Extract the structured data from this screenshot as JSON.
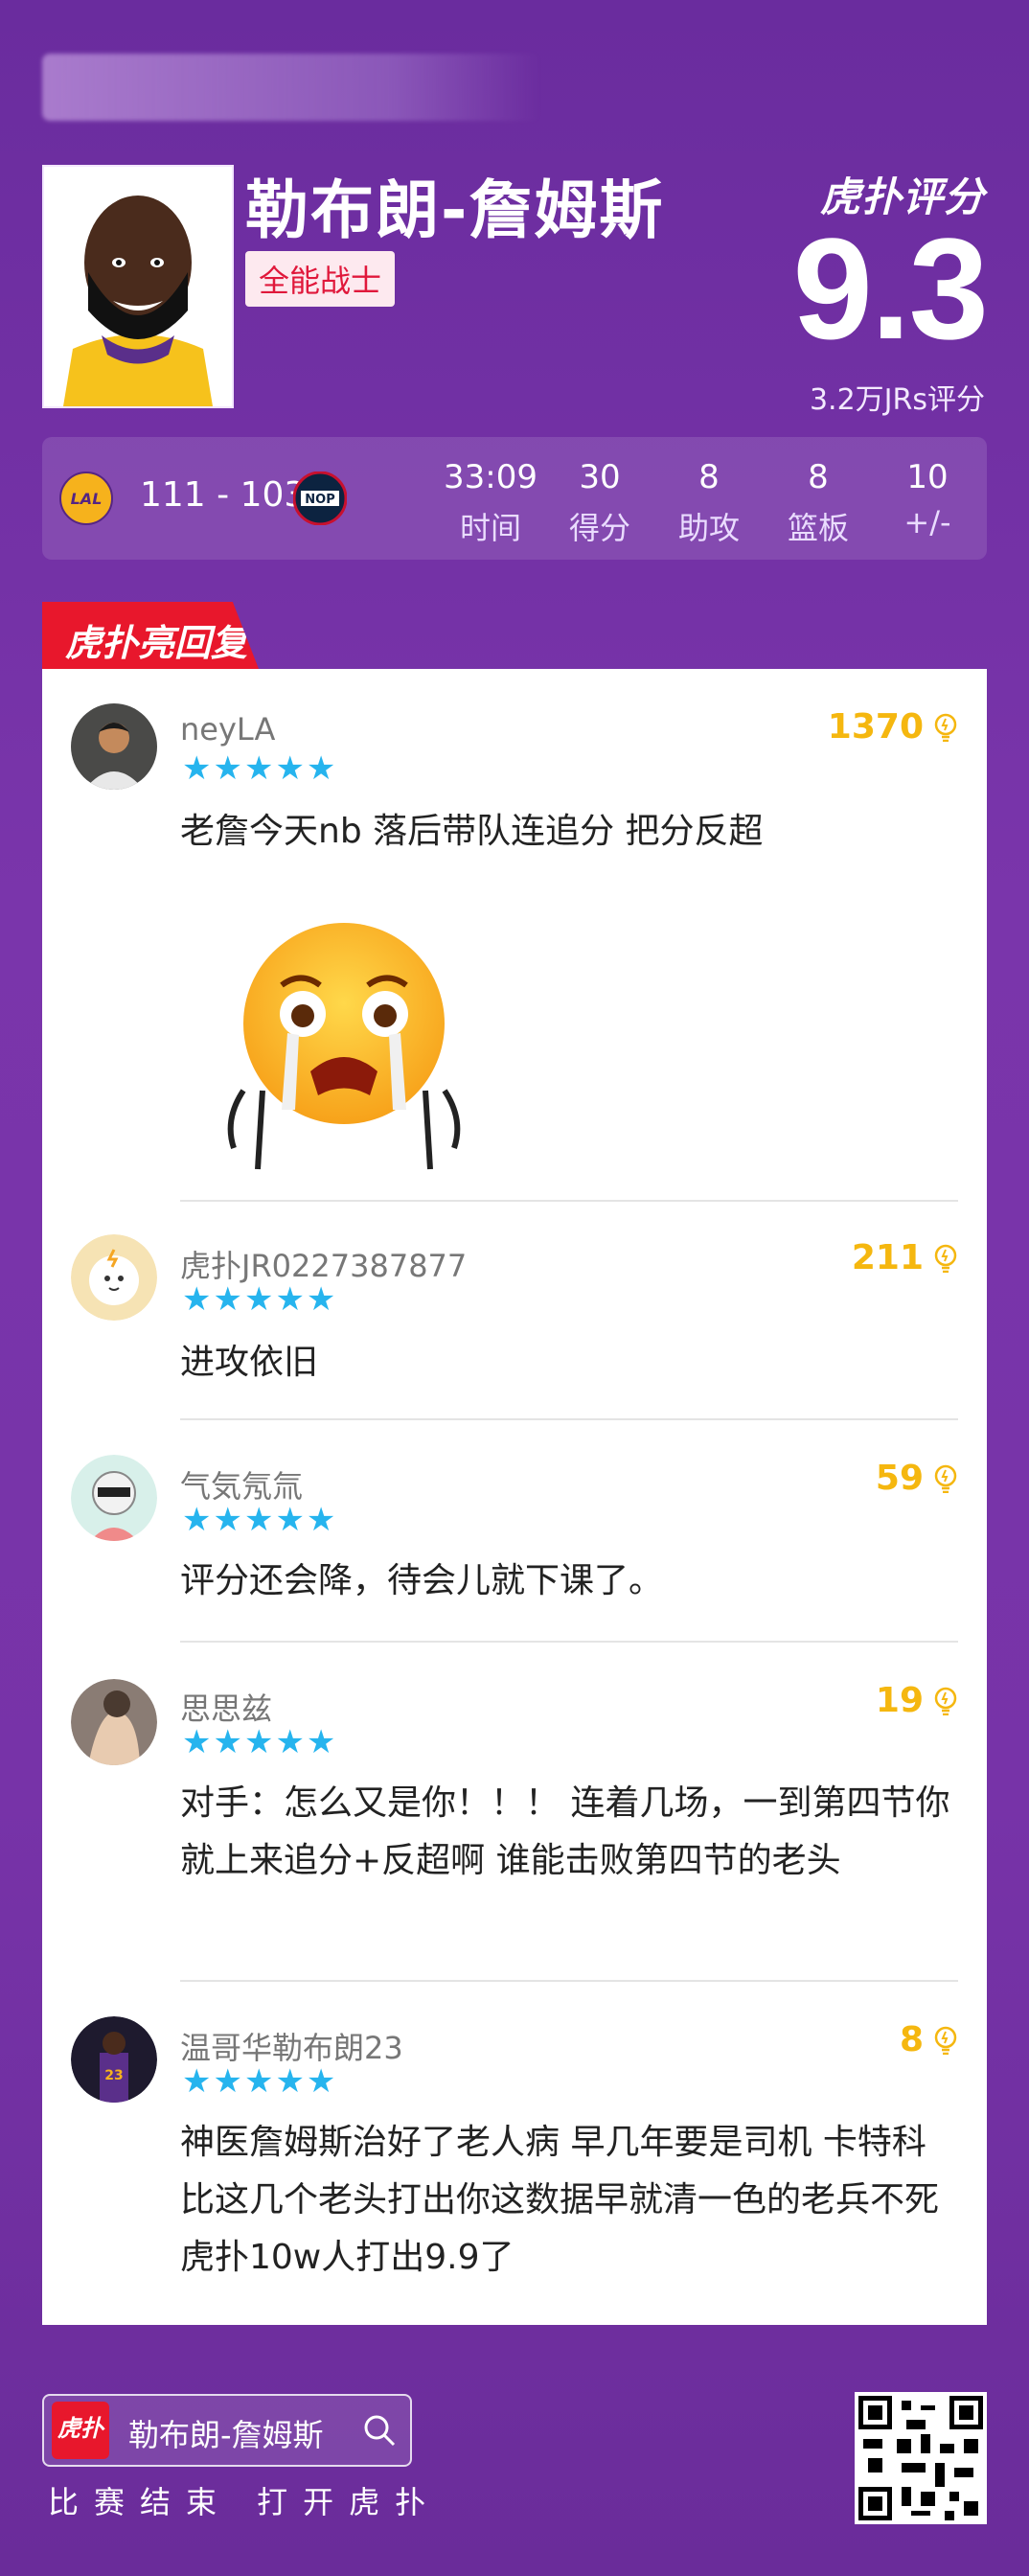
{
  "player": {
    "name": "勒布朗-詹姆斯",
    "tag": "全能战士"
  },
  "rating": {
    "brand": "虎扑评分",
    "score": "9.3",
    "votes": "3.2万JRs评分"
  },
  "game": {
    "score": "111 - 103",
    "home_logo": "LAL",
    "away_logo": "NOP",
    "stats": [
      {
        "value": "33:09",
        "label": "时间"
      },
      {
        "value": "30",
        "label": "得分"
      },
      {
        "value": "8",
        "label": "助攻"
      },
      {
        "value": "8",
        "label": "篮板"
      },
      {
        "value": "10",
        "label": "+/-"
      }
    ]
  },
  "section_title": "虎扑亮回复",
  "comments": [
    {
      "user": "neyLA",
      "stars": 5,
      "likes": "1370",
      "text": "老詹今天nb 落后带队连追分 把分反超",
      "sticker": "crying-emoji"
    },
    {
      "user": "虎扑JR0227387877",
      "stars": 5,
      "likes": "211",
      "text": "进攻依旧"
    },
    {
      "user": "气気氖氚",
      "stars": 5,
      "likes": "59",
      "text": "评分还会降，待会儿就下课了。"
    },
    {
      "user": "思思兹",
      "stars": 5,
      "likes": "19",
      "text": "对手：怎么又是你！！！ 连着几场，一到第四节你就上来追分+反超啊 谁能击败第四节的老头"
    },
    {
      "user": "温哥华勒布朗23",
      "stars": 5,
      "likes": "8",
      "text": "神医詹姆斯治好了老人病 早几年要是司机 卡特科比这几个老头打出你这数据早就清一色的老兵不死 虎扑10w人打出9.9了"
    }
  ],
  "footer": {
    "app_logo": "虎扑",
    "search_text": "勒布朗-詹姆斯",
    "cta": "比赛结束 打开虎扑"
  },
  "colors": {
    "background": "#7432a6",
    "accent_red": "#e8172c",
    "star_blue": "#26b4ee",
    "likes_gold": "#f5b70f"
  }
}
